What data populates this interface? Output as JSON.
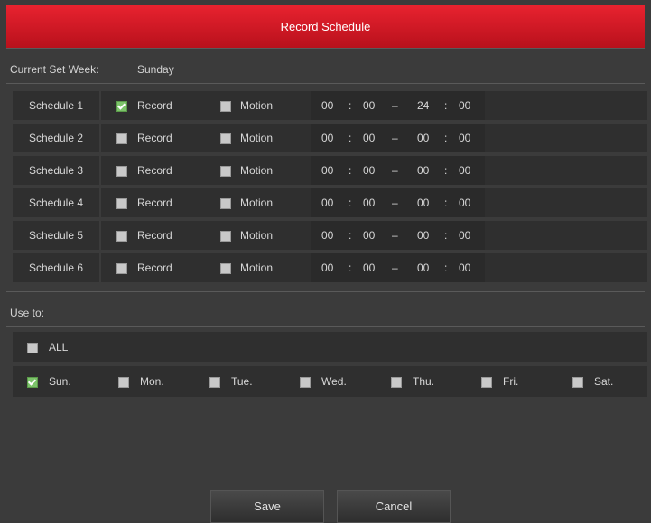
{
  "title": "Record Schedule",
  "current_week": {
    "label": "Current Set Week:",
    "value": "Sunday"
  },
  "schedules": [
    {
      "name": "Schedule 1",
      "record_label": "Record",
      "record": true,
      "motion_label": "Motion",
      "motion": false,
      "start_h": "00",
      "start_m": "00",
      "end_h": "24",
      "end_m": "00"
    },
    {
      "name": "Schedule 2",
      "record_label": "Record",
      "record": false,
      "motion_label": "Motion",
      "motion": false,
      "start_h": "00",
      "start_m": "00",
      "end_h": "00",
      "end_m": "00"
    },
    {
      "name": "Schedule 3",
      "record_label": "Record",
      "record": false,
      "motion_label": "Motion",
      "motion": false,
      "start_h": "00",
      "start_m": "00",
      "end_h": "00",
      "end_m": "00"
    },
    {
      "name": "Schedule 4",
      "record_label": "Record",
      "record": false,
      "motion_label": "Motion",
      "motion": false,
      "start_h": "00",
      "start_m": "00",
      "end_h": "00",
      "end_m": "00"
    },
    {
      "name": "Schedule 5",
      "record_label": "Record",
      "record": false,
      "motion_label": "Motion",
      "motion": false,
      "start_h": "00",
      "start_m": "00",
      "end_h": "00",
      "end_m": "00"
    },
    {
      "name": "Schedule 6",
      "record_label": "Record",
      "record": false,
      "motion_label": "Motion",
      "motion": false,
      "start_h": "00",
      "start_m": "00",
      "end_h": "00",
      "end_m": "00"
    }
  ],
  "time_colon": ":",
  "time_dash": "–",
  "use_to_label": "Use to:",
  "all": {
    "label": "ALL",
    "checked": false
  },
  "days": [
    {
      "label": "Sun.",
      "checked": true
    },
    {
      "label": "Mon.",
      "checked": false
    },
    {
      "label": "Tue.",
      "checked": false
    },
    {
      "label": "Wed.",
      "checked": false
    },
    {
      "label": "Thu.",
      "checked": false
    },
    {
      "label": "Fri.",
      "checked": false
    },
    {
      "label": "Sat.",
      "checked": false
    }
  ],
  "buttons": {
    "save": "Save",
    "cancel": "Cancel"
  },
  "colors": {
    "title_bar": "#d01a26",
    "checked": "#7cc36a",
    "background": "#3b3b3b"
  }
}
